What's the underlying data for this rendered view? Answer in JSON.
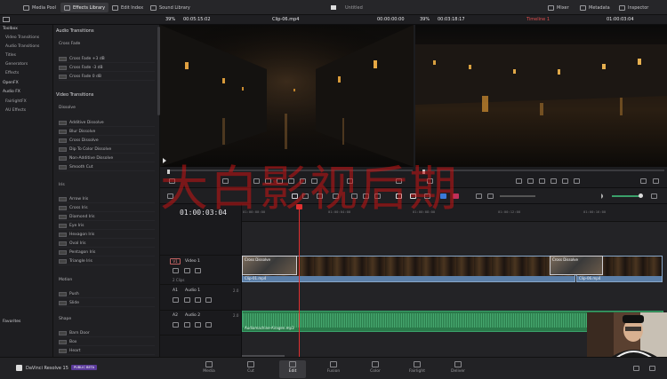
{
  "topbar": {
    "media_pool": "Media Pool",
    "effects_library": "Effects Library",
    "edit_index": "Edit Index",
    "sound_library": "Sound Library",
    "mixer": "Mixer",
    "metadata": "Metadata",
    "inspector": "Inspector",
    "center_label": "Untitled"
  },
  "viewer_bar": {
    "zoom_left": "39%",
    "tc_left": "00:05:15:02",
    "clip_name": "Clip-06.mp4",
    "tc_src": "00:00:00:00",
    "zoom_right": "39%",
    "tc_right": "00:03:18:17",
    "timeline_name": "Timeline 1",
    "tc_timeline": "01:00:03:04"
  },
  "left_panel": {
    "items": [
      {
        "label": "Toolbox",
        "hd": true
      },
      {
        "label": "Video Transitions"
      },
      {
        "label": "Audio Transitions"
      },
      {
        "label": "Titles"
      },
      {
        "label": "Generators"
      },
      {
        "label": "Effects"
      },
      {
        "label": "OpenFX",
        "hd": true
      },
      {
        "label": "Audio FX",
        "hd": true
      },
      {
        "label": "FairlightFX"
      },
      {
        "label": "AU Effects"
      }
    ],
    "favorites": "Favorites"
  },
  "fx_panel": {
    "audio_heading": "Audio Transitions",
    "cross_fade_heading": "Cross Fade",
    "cross_fade": [
      "Cross Fade +3 dB",
      "Cross Fade -3 dB",
      "Cross Fade 0 dB"
    ],
    "video_heading": "Video Transitions",
    "dissolve_heading": "Dissolve",
    "dissolve": [
      "Additive Dissolve",
      "Blur Dissolve",
      "Cross Dissolve",
      "Dip To Color Dissolve",
      "Non-Additive Dissolve",
      "Smooth Cut"
    ],
    "iris_heading": "Iris",
    "iris": [
      "Arrow Iris",
      "Cross Iris",
      "Diamond Iris",
      "Eye Iris",
      "Hexagon Iris",
      "Oval Iris",
      "Pentagon Iris",
      "Triangle Iris"
    ],
    "motion_heading": "Motion",
    "motion": [
      "Push",
      "Slide"
    ],
    "shape_heading": "Shape",
    "shape": [
      "Barn Door",
      "Box",
      "Heart"
    ]
  },
  "timeline": {
    "timecode": "01:00:03:04",
    "ticks": [
      "01:00:00:00",
      "01:00:04:00",
      "01:00:08:00",
      "01:00:12:00",
      "01:00:16:00"
    ],
    "tracks": {
      "v1_id": "V1",
      "v1_name": "Video 1",
      "v1_count": "2 Clips",
      "a1_id": "A1",
      "a1_name": "Audio 1",
      "a1_level": "2.0",
      "a2_id": "A2",
      "a2_name": "Audio 2",
      "a2_level": "2.0"
    },
    "clips": {
      "trans1": "Cross Dissolve",
      "trans2": "Cross Dissolve",
      "clip1": "Clip-01.mp4",
      "clip2": "Clip-06.mp4",
      "audio": "Audiomachine-Airagen.mp3"
    }
  },
  "bottombar": {
    "app": "DaVinci Resolve 15",
    "badge": "PUBLIC BETA",
    "pages": [
      "Media",
      "Cut",
      "Edit",
      "Fusion",
      "Color",
      "Fairlight",
      "Deliver"
    ],
    "active": "Edit"
  },
  "watermark": "大白影视后期"
}
